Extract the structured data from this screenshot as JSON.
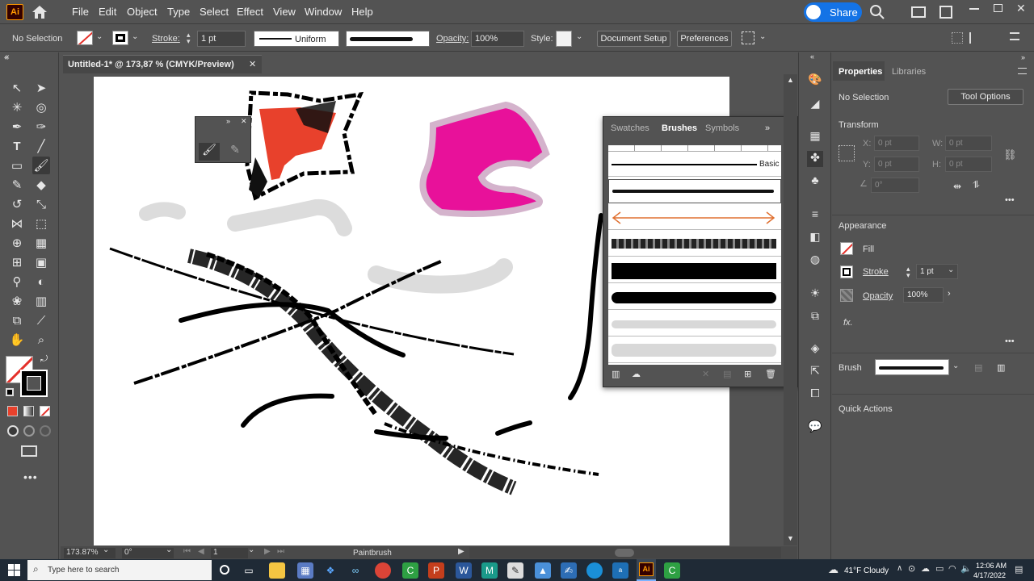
{
  "menubar": {
    "app_logo": "Ai",
    "items": [
      "File",
      "Edit",
      "Object",
      "Type",
      "Select",
      "Effect",
      "View",
      "Window",
      "Help"
    ],
    "share_label": "Share"
  },
  "control_bar": {
    "selection": "No Selection",
    "stroke_label": "Stroke:",
    "stroke_weight": "1 pt",
    "profile": "Uniform",
    "opacity_label": "Opacity:",
    "opacity": "100%",
    "style_label": "Style:",
    "document_setup": "Document Setup",
    "preferences": "Preferences"
  },
  "document": {
    "tab_title": "Untitled-1* @ 173,87 % (CMYK/Preview)",
    "zoom": "173.87%",
    "rotation": "0°",
    "artboard": "1",
    "status_tool": "Paintbrush"
  },
  "brushes_panel": {
    "tabs": [
      "Swatches",
      "Brushes",
      "Symbols"
    ],
    "active_tab": "Brushes",
    "basic_label": "Basic"
  },
  "properties": {
    "tabs": [
      "Properties",
      "Libraries"
    ],
    "selection": "No Selection",
    "tool_options": "Tool Options",
    "transform_title": "Transform",
    "x_label": "X:",
    "x_value": "0 pt",
    "y_label": "Y:",
    "y_value": "0 pt",
    "w_label": "W:",
    "w_value": "0 pt",
    "h_label": "H:",
    "h_value": "0 pt",
    "angle_value": "0°",
    "appearance_title": "Appearance",
    "fill_label": "Fill",
    "stroke_label": "Stroke",
    "stroke_value": "1 pt",
    "opacity_label": "Opacity",
    "opacity_value": "100%",
    "fx_label": "fx.",
    "brush_label": "Brush",
    "quick_actions": "Quick Actions"
  },
  "taskbar": {
    "search_placeholder": "Type here to search",
    "weather": "41°F  Cloudy",
    "time": "12:06 AM",
    "date": "4/17/2022"
  },
  "colors": {
    "accent_blue": "#1473e6",
    "ai_orange": "#ff9a00",
    "ai_bg": "#330000",
    "magenta": "#e8119a",
    "red_fill": "#e8412c"
  }
}
